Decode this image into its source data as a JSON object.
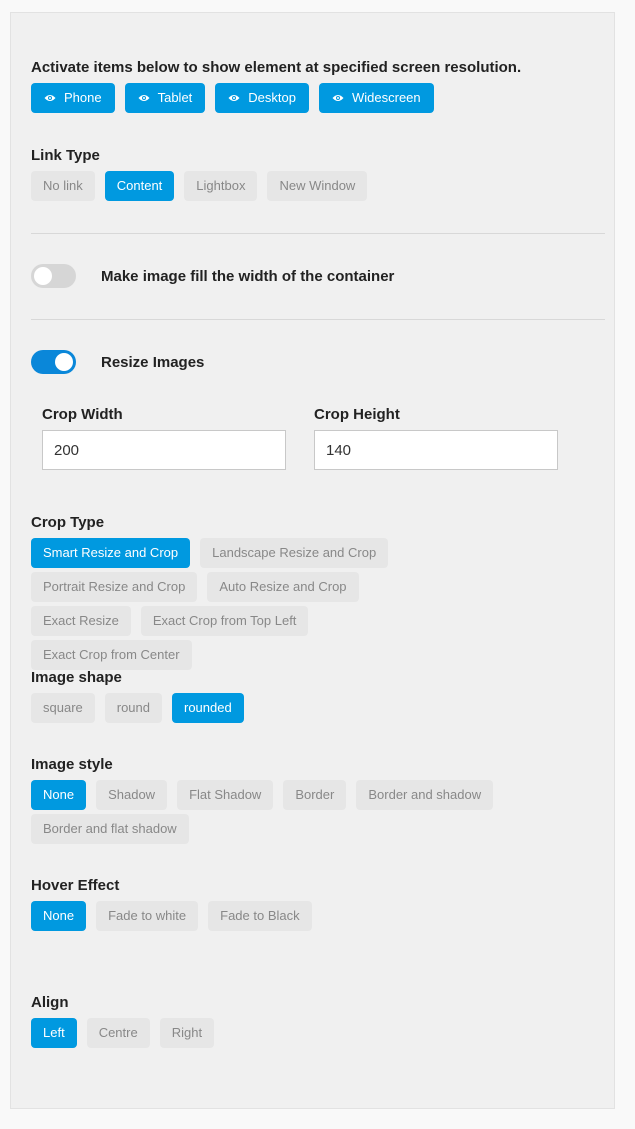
{
  "colors": {
    "accent": "#0099e0",
    "toggle_on": "#0a87d9",
    "inactive_bg": "#e6e6e6",
    "inactive_text": "#888888"
  },
  "visibility": {
    "label": "Activate items below to show element at specified screen resolution.",
    "devices": [
      {
        "label": "Phone",
        "icon": "eye-icon",
        "active": true
      },
      {
        "label": "Tablet",
        "icon": "eye-icon",
        "active": true
      },
      {
        "label": "Desktop",
        "icon": "eye-icon",
        "active": true
      },
      {
        "label": "Widescreen",
        "icon": "eye-icon",
        "active": true
      }
    ]
  },
  "link_type": {
    "label": "Link Type",
    "options": [
      "No link",
      "Content",
      "Lightbox",
      "New Window"
    ],
    "selected": "Content"
  },
  "fill_width": {
    "label": "Make image fill the width of the container",
    "on": false
  },
  "resize_images": {
    "label": "Resize Images",
    "on": true
  },
  "crop_width": {
    "label": "Crop Width",
    "value": "200"
  },
  "crop_height": {
    "label": "Crop Height",
    "value": "140"
  },
  "crop_type": {
    "label": "Crop Type",
    "options": [
      "Smart Resize and Crop",
      "Landscape Resize and Crop",
      "Portrait Resize and Crop",
      "Auto Resize and Crop",
      "Exact Resize",
      "Exact Crop from Top Left",
      "Exact Crop from Center"
    ],
    "selected": "Smart Resize and Crop"
  },
  "image_shape": {
    "label": "Image shape",
    "options": [
      "square",
      "round",
      "rounded"
    ],
    "selected": "rounded"
  },
  "image_style": {
    "label": "Image style",
    "options": [
      "None",
      "Shadow",
      "Flat Shadow",
      "Border",
      "Border and shadow",
      "Border and flat shadow"
    ],
    "selected": "None"
  },
  "hover_effect": {
    "label": "Hover Effect",
    "options": [
      "None",
      "Fade to white",
      "Fade to Black"
    ],
    "selected": "None"
  },
  "align": {
    "label": "Align",
    "options": [
      "Left",
      "Centre",
      "Right"
    ],
    "selected": "Left"
  }
}
